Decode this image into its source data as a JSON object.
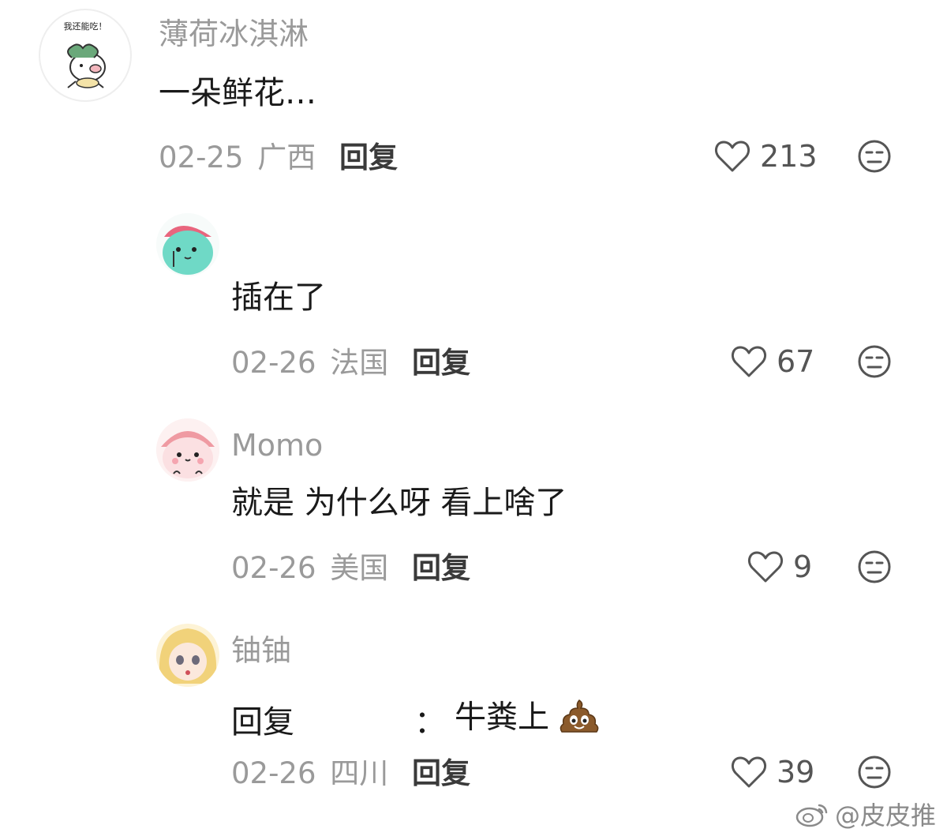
{
  "comments": [
    {
      "username": "薄荷冰淇淋",
      "avatar_caption": "我还能吃！",
      "content": "一朵鲜花…",
      "date": "02-25",
      "location": "广西",
      "reply_label": "回复",
      "likes": "213"
    },
    {
      "username": "",
      "content": "插在了",
      "date": "02-26",
      "location": "法国",
      "reply_label": "回复",
      "likes": "67"
    },
    {
      "username": "Momo",
      "content": "就是 为什么呀 看上啥了",
      "date": "02-26",
      "location": "美国",
      "reply_label": "回复",
      "likes": "9"
    },
    {
      "username": "铀铀",
      "reply_prefix": "回复",
      "reply_colon": "：",
      "content": "牛粪上",
      "content_emoji": "poop-emoji",
      "date": "02-26",
      "location": "四川",
      "reply_label": "回复",
      "likes": "39"
    }
  ],
  "watermark": {
    "text": "@皮皮推",
    "icon": "weibo-icon"
  },
  "colors": {
    "meta_gray": "#9a9a9a",
    "icon_gray": "#555555",
    "text": "#1a1a1a"
  }
}
